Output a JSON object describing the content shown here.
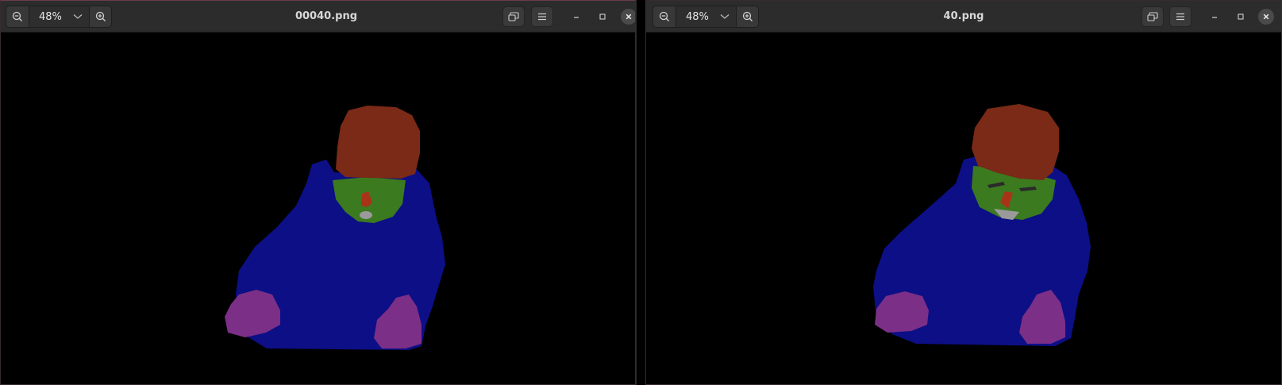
{
  "windows": [
    {
      "title": "00040.png",
      "zoom": "48%"
    },
    {
      "title": "40.png",
      "zoom": "48%"
    }
  ],
  "colors": {
    "headerbar": "#2c2c2c",
    "hair": "#7a2a16",
    "face": "#3b7a1f",
    "body": "#0d0f86",
    "hands": "#7b2f86",
    "mouth": "#9a9a9a",
    "nose": "#a83418",
    "background": "#000000"
  },
  "icons": {
    "zoom_out": "zoom-out-icon",
    "zoom_in": "zoom-in-icon",
    "dropdown": "chevron-down-icon",
    "gallery": "gallery-icon",
    "menu": "menu-icon",
    "minimize": "minimize-icon",
    "maximize": "maximize-icon",
    "close": "close-icon"
  }
}
